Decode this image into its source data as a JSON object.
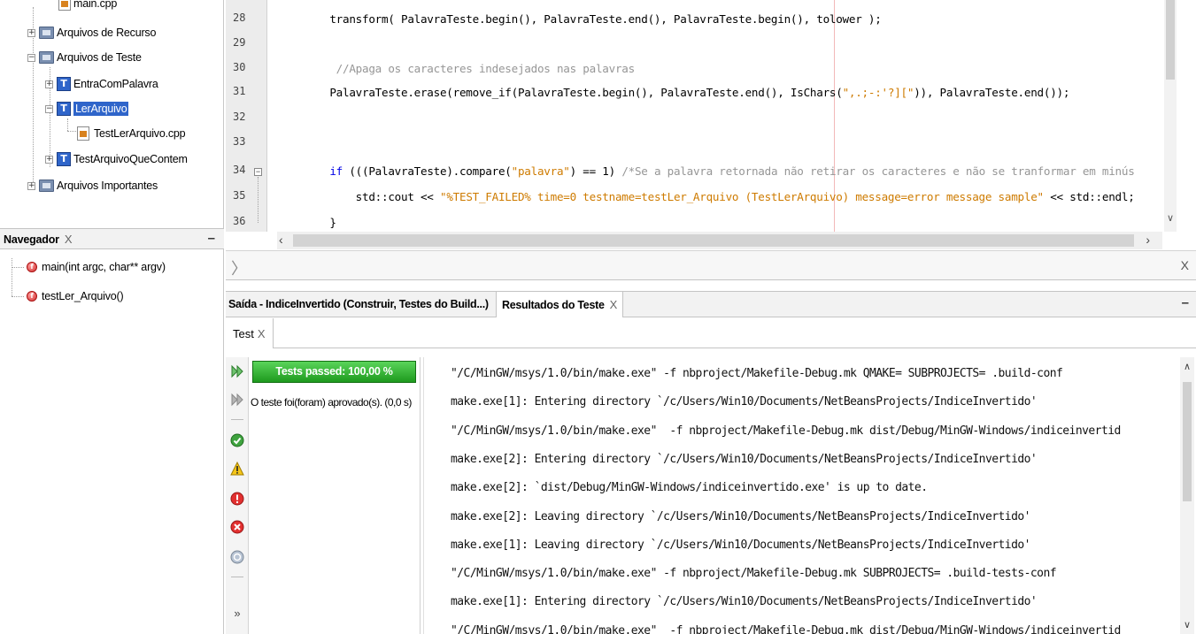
{
  "project_tree": {
    "items": [
      {
        "label": "main.cpp",
        "level": 3,
        "icon": "file-icon",
        "selected": false
      },
      {
        "label": "Arquivos de Recurso",
        "level": 1,
        "icon": "folder-icon",
        "selected": false
      },
      {
        "label": "Arquivos de Teste",
        "level": 1,
        "icon": "folder-icon",
        "selected": false
      },
      {
        "label": "EntraComPalavra",
        "level": 2,
        "icon": "test-folder-icon",
        "selected": false
      },
      {
        "label": "LerArquivo",
        "level": 2,
        "icon": "test-folder-icon",
        "selected": true
      },
      {
        "label": "TestLerArquivo.cpp",
        "level": 3,
        "icon": "file-icon",
        "selected": false
      },
      {
        "label": "TestArquivoQueContem",
        "level": 2,
        "icon": "test-folder-icon",
        "selected": false
      },
      {
        "label": "Arquivos Importantes",
        "level": 1,
        "icon": "folder-icon",
        "selected": false
      }
    ]
  },
  "navigator": {
    "title": "Navegador",
    "close": "X",
    "minimize": "–",
    "items": [
      {
        "label": "main(int argc, char** argv)"
      },
      {
        "label": "testLer_Arquivo()"
      }
    ]
  },
  "editor": {
    "lines": [
      {
        "num": "28",
        "parts": [
          [
            "",
            "    transform( PalavraTeste.begin(), PalavraTeste.end(), PalavraTeste.begin(), tolower );"
          ]
        ]
      },
      {
        "num": "29",
        "parts": []
      },
      {
        "num": "30",
        "parts": [
          [
            "cmt",
            "     //Apaga os caracteres indesejados nas palavras"
          ]
        ]
      },
      {
        "num": "31",
        "parts": [
          [
            "",
            "    PalavraTeste.erase(remove_if(PalavraTeste.begin(), PalavraTeste.end(), IsChars("
          ],
          [
            "str",
            "\",.;-:'?][\""
          ],
          [
            "",
            ")), PalavraTeste.end());"
          ]
        ]
      },
      {
        "num": "32",
        "parts": []
      },
      {
        "num": "33",
        "parts": []
      },
      {
        "num": "34",
        "parts": [
          [
            "kw",
            "    if"
          ],
          [
            "",
            " (((PalavraTeste).compare("
          ],
          [
            "str",
            "\"palavra\""
          ],
          [
            "",
            ") == 1) "
          ],
          [
            "cmt",
            "/*Se a palavra retornada não retirar os caracteres e não se tranformar em minús"
          ]
        ]
      },
      {
        "num": "35",
        "parts": [
          [
            "",
            "        std::cout << "
          ],
          [
            "str",
            "\"%TEST_FAILED% time=0 testname=testLer_Arquivo (TestLerArquivo) message=error message sample\""
          ],
          [
            "",
            " << std::endl;"
          ]
        ]
      },
      {
        "num": "36",
        "parts": [
          [
            "",
            "    }"
          ]
        ]
      }
    ]
  },
  "output_window": {
    "tabs": [
      {
        "label": "Saída - IndiceInvertido (Construir, Testes do Build...)"
      },
      {
        "label": "Resultados do Teste",
        "close": "X"
      }
    ],
    "minimize": "–",
    "subtab": {
      "label": "Test",
      "close": "X"
    },
    "progress_label": "Tests passed: 100,00 %",
    "progress_value": 1.0,
    "summary": "O teste foi(foram) aprovado(s). (0,0 s)",
    "toolbar_icons": [
      "rerun-icon",
      "rerun-failed-icon",
      "show-passed-icon",
      "show-warnings-icon",
      "show-failures-icon",
      "show-errors-icon",
      "show-aborted-icon",
      "more-icon"
    ],
    "console_lines": [
      "\"/C/MinGW/msys/1.0/bin/make.exe\" -f nbproject/Makefile-Debug.mk QMAKE= SUBPROJECTS= .build-conf",
      "make.exe[1]: Entering directory `/c/Users/Win10/Documents/NetBeansProjects/IndiceInvertido'",
      "\"/C/MinGW/msys/1.0/bin/make.exe\"  -f nbproject/Makefile-Debug.mk dist/Debug/MinGW-Windows/indiceinvertid",
      "make.exe[2]: Entering directory `/c/Users/Win10/Documents/NetBeansProjects/IndiceInvertido'",
      "make.exe[2]: `dist/Debug/MinGW-Windows/indiceinvertido.exe' is up to date.",
      "make.exe[2]: Leaving directory `/c/Users/Win10/Documents/NetBeansProjects/IndiceInvertido'",
      "make.exe[1]: Leaving directory `/c/Users/Win10/Documents/NetBeansProjects/IndiceInvertido'",
      "\"/C/MinGW/msys/1.0/bin/make.exe\" -f nbproject/Makefile-Debug.mk SUBPROJECTS= .build-tests-conf",
      "make.exe[1]: Entering directory `/c/Users/Win10/Documents/NetBeansProjects/IndiceInvertido'",
      "\"/C/MinGW/msys/1.0/bin/make.exe\"  -f nbproject/Makefile-Debug.mk dist/Debug/MinGW-Windows/indiceinvertid"
    ]
  },
  "colors": {
    "selection": "#2f65ca",
    "progress_green": "#2eb52e",
    "keyword": "#0000e6",
    "string": "#ce7b00",
    "comment": "#969696"
  }
}
